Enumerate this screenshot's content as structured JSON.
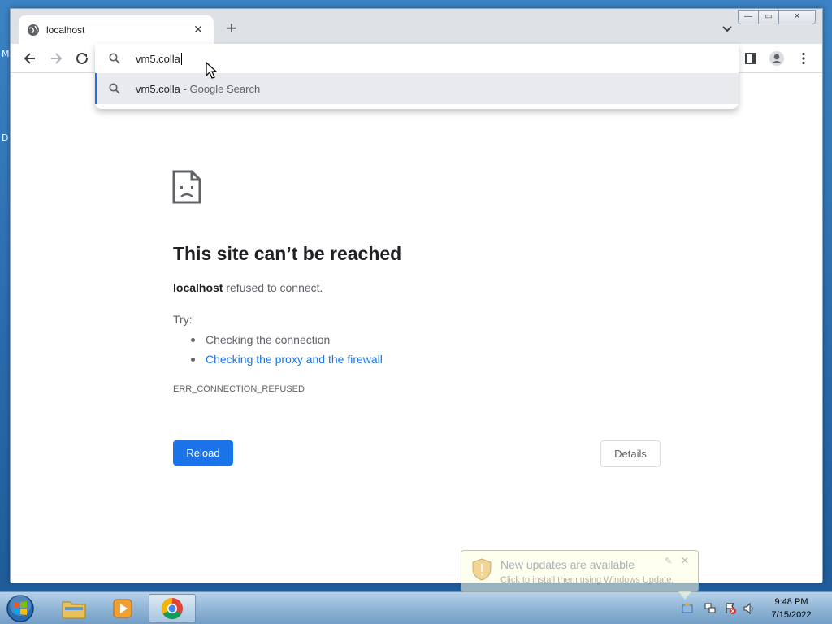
{
  "desktop": {
    "edge_letters": [
      "M",
      "D"
    ]
  },
  "browser": {
    "tab": {
      "title": "localhost",
      "close_glyph": "✕"
    },
    "new_tab_glyph": "+",
    "window_controls": {
      "minimize": "—",
      "maximize": "▭",
      "close": "✕"
    },
    "omnibox": {
      "typed_text": "vm5.colla",
      "suggestion": {
        "query": "vm5.colla",
        "separator": " - ",
        "engine_label": "Google Search"
      }
    }
  },
  "error_page": {
    "title": "This site can’t be reached",
    "host": "localhost",
    "message": " refused to connect.",
    "try_label": "Try:",
    "suggestions": [
      {
        "text": "Checking the connection",
        "is_link": false
      },
      {
        "text": "Checking the proxy and the firewall",
        "is_link": true
      }
    ],
    "error_code": "ERR_CONNECTION_REFUSED",
    "reload_label": "Reload",
    "details_label": "Details"
  },
  "notification": {
    "title": "New updates are available",
    "body": "Click to install them using Windows Update.",
    "close_glyph": "✕",
    "pin_glyph": "✎"
  },
  "taskbar": {
    "clock_time": "9:48 PM",
    "clock_date": "7/15/2022"
  },
  "colors": {
    "accent_blue": "#1a73e8",
    "text_primary": "#202124",
    "text_secondary": "#5f6368"
  }
}
